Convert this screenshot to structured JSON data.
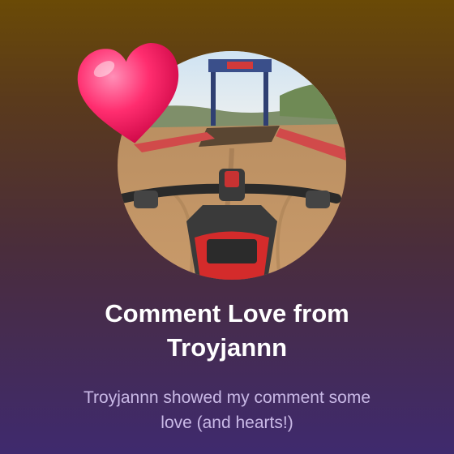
{
  "notification": {
    "title_line1": "Comment Love from",
    "title_line2": "Troyjannn",
    "subtitle_line1": "Troyjannn showed my comment some",
    "subtitle_line2": "love (and hearts!)"
  },
  "avatar": {
    "icon": "motocross-first-person-photo"
  },
  "badge": {
    "icon": "heart-icon",
    "color": "#ff2d6f"
  },
  "colors": {
    "background_top": "#6a4a06",
    "background_bottom": "#3f2a6e",
    "title": "#ffffff",
    "subtitle": "#c9b9e6"
  }
}
